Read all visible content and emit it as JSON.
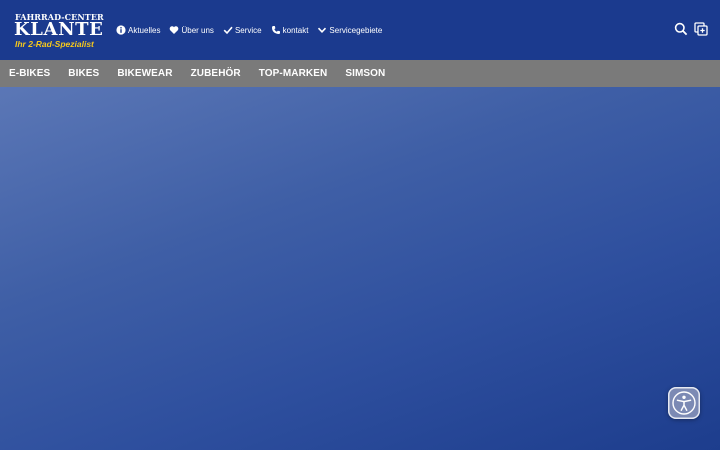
{
  "logo": {
    "line1": "FAHRRAD-CENTER",
    "line2": "KLANTE",
    "tagline": "Ihr 2-Rad-Spezialist"
  },
  "top_nav": {
    "items": [
      {
        "label": "Aktuelles",
        "icon": "info-circle-icon"
      },
      {
        "label": "Über uns",
        "icon": "heart-icon"
      },
      {
        "label": "Service",
        "icon": "checkmark-icon"
      },
      {
        "label": "kontakt",
        "icon": "phone-icon"
      },
      {
        "label": "Servicegebiete",
        "icon": "chevron-down-icon"
      }
    ]
  },
  "header_icons": {
    "search": "search-icon",
    "window": "new-window-icon"
  },
  "category_nav": {
    "items": [
      {
        "label": "E-BIKES"
      },
      {
        "label": "BIKES"
      },
      {
        "label": "BIKEWEAR"
      },
      {
        "label": "ZUBEHÖR"
      },
      {
        "label": "TOP-MARKEN"
      },
      {
        "label": "SIMSON"
      }
    ]
  },
  "accessibility": {
    "icon": "accessibility-person-icon"
  },
  "colors": {
    "header_bg": "#1b3a8e",
    "nav_bg": "#7a7a7a",
    "tagline": "#f6c81c",
    "hero_light": "#5b77b6",
    "hero_dark": "#1d3d8d"
  }
}
